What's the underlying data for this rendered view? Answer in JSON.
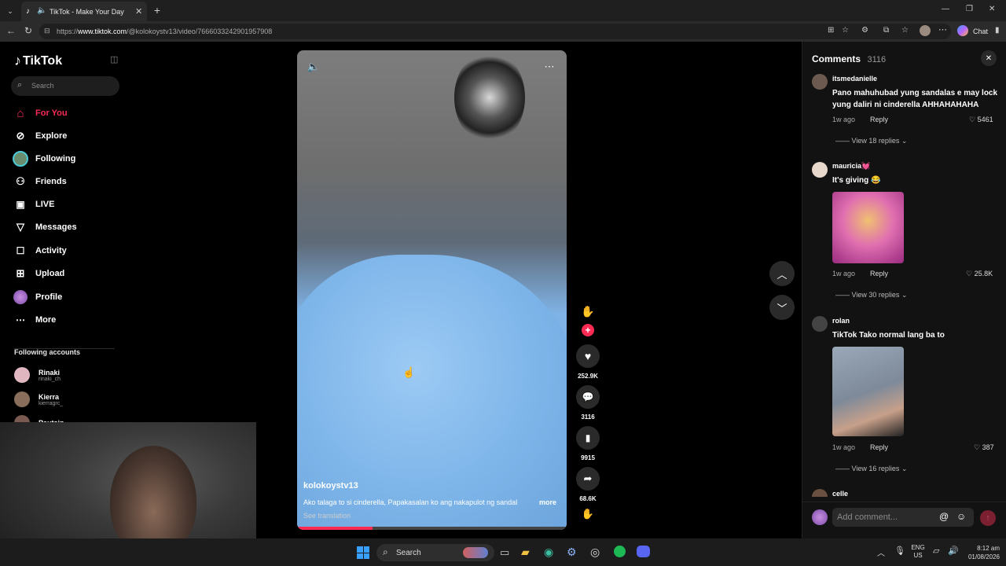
{
  "browser": {
    "tab_title": "TikTok - Make Your Day",
    "url_prefix": "https://",
    "url_host": "www.tiktok.com",
    "url_path": "/@kolokoystv13/video/7666033242901957908",
    "chat_label": "Chat"
  },
  "sidebar": {
    "logo": "TikTok",
    "search_placeholder": "Search",
    "nav": [
      {
        "label": "For You",
        "icon": "home-icon",
        "active": true
      },
      {
        "label": "Explore",
        "icon": "compass-icon"
      },
      {
        "label": "Following",
        "icon": "following-avatar-icon"
      },
      {
        "label": "Friends",
        "icon": "friends-icon"
      },
      {
        "label": "LIVE",
        "icon": "live-icon"
      },
      {
        "label": "Messages",
        "icon": "messages-icon"
      },
      {
        "label": "Activity",
        "icon": "activity-icon"
      },
      {
        "label": "Upload",
        "icon": "upload-icon"
      },
      {
        "label": "Profile",
        "icon": "profile-avatar-icon"
      },
      {
        "label": "More",
        "icon": "more-icon"
      }
    ],
    "following_title": "Following accounts",
    "accounts": [
      {
        "name": "Rinaki",
        "handle": "rinaki_ch"
      },
      {
        "name": "Kierra",
        "handle": "kierragrc_"
      },
      {
        "name": "Pautsin",
        "handle": ""
      }
    ]
  },
  "video": {
    "author": "kolokoystv13",
    "caption": "Ako talaga to si cinderella, Papakasalan ko ang nakapulot ng sandal",
    "more": "more",
    "see_translation": "See translation",
    "progress": 0.28
  },
  "actions": {
    "likes": "252.9K",
    "comments": "3116",
    "saves": "9915",
    "shares": "68.6K"
  },
  "comments_panel": {
    "title": "Comments",
    "count": "3116",
    "input_placeholder": "Add comment...",
    "items": [
      {
        "user": "itsmedanielle",
        "text": "Pano mahuhubad yung sandalas e may lock yung daliri ni cinderella AHHAHAHAHA",
        "time": "1w ago",
        "reply": "Reply",
        "likes": "5461",
        "replies": "View 18 replies"
      },
      {
        "user": "mauricia💓",
        "text": "It's giving 😂",
        "time": "1w ago",
        "reply": "Reply",
        "likes": "25.8K",
        "replies": "View 30 replies"
      },
      {
        "user": "rolan",
        "text": "TikTok Tako normal lang ba to",
        "time": "1w ago",
        "reply": "Reply",
        "likes": "387",
        "replies": "View 16 replies"
      },
      {
        "user": "celle",
        "text": "",
        "time": "",
        "reply": "",
        "likes": "",
        "replies": ""
      }
    ]
  },
  "taskbar": {
    "search": "Search",
    "lang": "ENG",
    "region": "US",
    "time": "8:12 am",
    "date": "01/08/2026"
  }
}
